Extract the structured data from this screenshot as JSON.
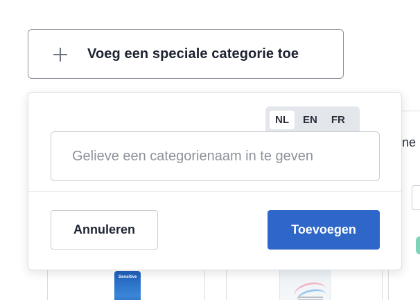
{
  "add_category": {
    "label": "Voeg een speciale categorie toe",
    "icon": "plus-icon"
  },
  "background": {
    "partial_heading": "ëne",
    "product_1_tag": "Sensitive"
  },
  "popover": {
    "languages": [
      {
        "code": "NL",
        "active": true
      },
      {
        "code": "EN",
        "active": false
      },
      {
        "code": "FR",
        "active": false
      }
    ],
    "name_input": {
      "value": "",
      "placeholder": "Gelieve een categorienaam in te geven"
    },
    "cancel_label": "Annuleren",
    "submit_label": "Toevoegen"
  },
  "colors": {
    "primary": "#2f67c9",
    "border": "#c9cdd4",
    "lang_tab_bg": "#e3e6eb",
    "badge": "#7fd3b8"
  }
}
